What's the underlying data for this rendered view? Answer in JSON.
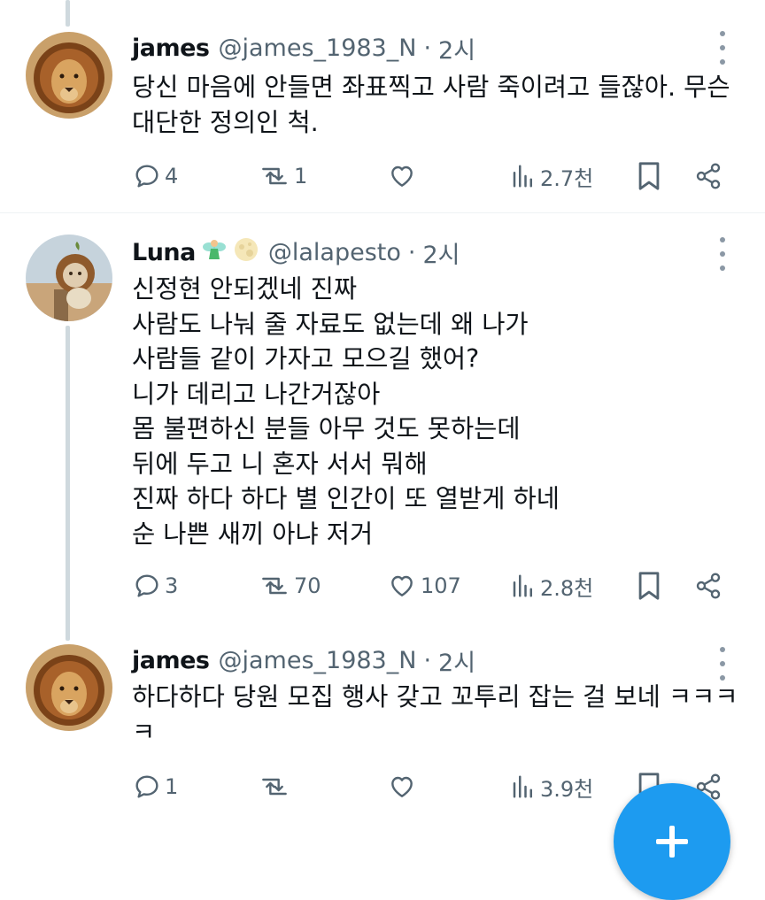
{
  "colors": {
    "text": "#0f1419",
    "muted": "#536471",
    "accent": "#1d9bf0",
    "line": "#cfd9de"
  },
  "tweets": [
    {
      "name": "james",
      "handle": "@james_1983_N",
      "time": "2시",
      "avatar": "lion-avatar",
      "lines": [
        "당신 마음에 안들면 좌표찍고 사람 죽이려고 들잖아. 무슨",
        "대단한 정의인 척."
      ],
      "replies": "4",
      "reposts": "1",
      "likes": "",
      "views": "2.7천"
    },
    {
      "name": "Luna",
      "handle": "@lalapesto",
      "time": "2시",
      "avatar": "cat-lion-avatar",
      "emojis": [
        "fairy-emoji",
        "full-moon-emoji"
      ],
      "lines": [
        "신정현 안되겠네 진짜",
        "사람도 나눠 줄 자료도 없는데 왜 나가",
        "사람들 같이 가자고 모으길 했어?",
        "니가 데리고 나간거잖아",
        "몸 불편하신 분들 아무 것도 못하는데",
        "뒤에 두고 니 혼자 서서 뭐해",
        "진짜 하다 하다 별 인간이 또 열받게 하네",
        "순 나쁜 새끼 아냐 저거"
      ],
      "replies": "3",
      "reposts": "70",
      "likes": "107",
      "views": "2.8천"
    },
    {
      "name": "james",
      "handle": "@james_1983_N",
      "time": "2시",
      "avatar": "lion-avatar",
      "lines": [
        "하다하다 당원 모집 행사 갖고 꼬투리 잡는 걸 보네 ㅋㅋㅋ",
        "ㅋ"
      ],
      "replies": "1",
      "reposts": "",
      "likes": "",
      "views": "3.9천"
    }
  ],
  "separator": "·",
  "fab": {
    "icon": "plus-icon"
  }
}
